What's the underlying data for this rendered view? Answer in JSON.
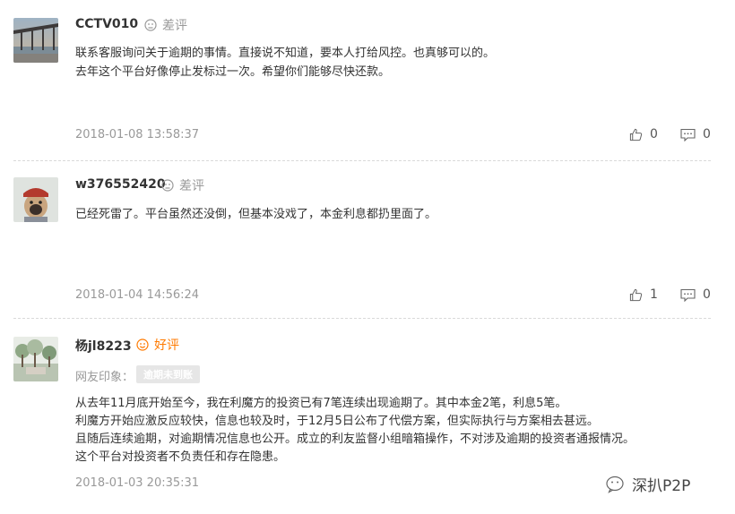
{
  "reviews": [
    {
      "username": "CCTV010",
      "rating": "差评",
      "lines": [
        "联系客服询问关于逾期的事情。直接说不知道，要本人打给风控。也真够可以的。",
        "去年这个平台好像停止发标过一次。希望你们能够尽快还款。"
      ],
      "time": "2018-01-08 13:58:37",
      "likes": "0",
      "comments": "0"
    },
    {
      "username": "w376552420",
      "rating": "差评",
      "lines": [
        "已经死雷了。平台虽然还没倒，但基本没戏了，本金利息都扔里面了。"
      ],
      "time": "2018-01-04 14:56:24",
      "likes": "1",
      "comments": "0"
    },
    {
      "username": "杨jl8223",
      "rating": "好评",
      "impression_label": "网友印象：",
      "impression_tag": "逾期未到账",
      "lines": [
        "从去年11月底开始至今，我在利魔方的投资已有7笔连续出现逾期了。其中本金2笔，利息5笔。",
        "利魔方开始应激反应较快，信息也较及时，于12月5日公布了代偿方案，但实际执行与方案相去甚远。",
        "且随后连续逾期，对逾期情况信息也公开。成立的利友监督小组暗箱操作，不对涉及逾期的投资者通报情况。",
        "这个平台对投资者不负责任和存在隐患。"
      ],
      "time": "2018-01-03 20:35:31"
    }
  ],
  "watermark": "深扒P2P",
  "colors": {
    "bad_rating": "#999999",
    "good_rating": "#ff7a00",
    "time": "#999999"
  },
  "icons": [
    "thumbs-up-icon",
    "comment-icon",
    "sad-face-icon",
    "smile-face-icon",
    "wechat-icon"
  ]
}
